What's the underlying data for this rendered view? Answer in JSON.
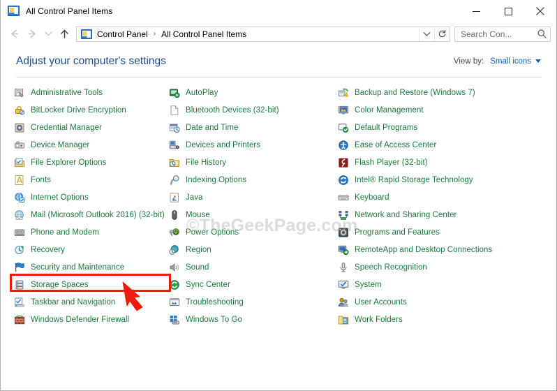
{
  "window": {
    "title": "All Control Panel Items",
    "title_icon": "control-panel-icon",
    "minimize_label": "Minimize",
    "maximize_label": "Maximize",
    "close_label": "Close"
  },
  "toolbar": {
    "back_label": "Back",
    "forward_label": "Forward",
    "recent_label": "Recent locations",
    "up_label": "Up",
    "breadcrumbs": [
      {
        "label": "Control Panel"
      },
      {
        "label": "All Control Panel Items"
      }
    ],
    "separator": "›",
    "address_dropdown_label": "Previous locations",
    "refresh_label": "Refresh",
    "search": {
      "placeholder": "Search Con...",
      "value": "",
      "icon": "search-icon"
    }
  },
  "header": {
    "title": "Adjust your computer's settings",
    "view_by_label": "View by:",
    "view_by_value": "Small icons"
  },
  "colors": {
    "link_green": "#1a7a3c",
    "title_blue": "#1f4e96",
    "accent_blue": "#0066cc",
    "annotation_red": "#f01b0c"
  },
  "annotations": {
    "highlight_target": "Mail (Microsoft Outlook 2016) (32-bit)",
    "arrow": "red-arrow-pointing-up-left",
    "watermark": "©TheGeekPage.com"
  },
  "columns": [
    {
      "items": [
        {
          "label": "Administrative Tools",
          "icon": "administrative-tools-icon"
        },
        {
          "label": "BitLocker Drive Encryption",
          "icon": "bitlocker-icon"
        },
        {
          "label": "Credential Manager",
          "icon": "credential-manager-icon"
        },
        {
          "label": "Device Manager",
          "icon": "device-manager-icon"
        },
        {
          "label": "File Explorer Options",
          "icon": "file-explorer-options-icon"
        },
        {
          "label": "Fonts",
          "icon": "fonts-icon"
        },
        {
          "label": "Internet Options",
          "icon": "internet-options-icon"
        },
        {
          "label": "Mail (Microsoft Outlook 2016) (32-bit)",
          "icon": "mail-icon"
        },
        {
          "label": "Phone and Modem",
          "icon": "phone-and-modem-icon"
        },
        {
          "label": "Recovery",
          "icon": "recovery-icon"
        },
        {
          "label": "Security and Maintenance",
          "icon": "security-and-maintenance-icon"
        },
        {
          "label": "Storage Spaces",
          "icon": "storage-spaces-icon"
        },
        {
          "label": "Taskbar and Navigation",
          "icon": "taskbar-and-navigation-icon"
        },
        {
          "label": "Windows Defender Firewall",
          "icon": "windows-defender-firewall-icon"
        }
      ]
    },
    {
      "items": [
        {
          "label": "AutoPlay",
          "icon": "autoplay-icon"
        },
        {
          "label": "Bluetooth Devices (32-bit)",
          "icon": "bluetooth-devices-icon"
        },
        {
          "label": "Date and Time",
          "icon": "date-and-time-icon"
        },
        {
          "label": "Devices and Printers",
          "icon": "devices-and-printers-icon"
        },
        {
          "label": "File History",
          "icon": "file-history-icon"
        },
        {
          "label": "Indexing Options",
          "icon": "indexing-options-icon"
        },
        {
          "label": "Java",
          "icon": "java-icon"
        },
        {
          "label": "Mouse",
          "icon": "mouse-icon"
        },
        {
          "label": "Power Options",
          "icon": "power-options-icon"
        },
        {
          "label": "Region",
          "icon": "region-icon"
        },
        {
          "label": "Sound",
          "icon": "sound-icon"
        },
        {
          "label": "Sync Center",
          "icon": "sync-center-icon"
        },
        {
          "label": "Troubleshooting",
          "icon": "troubleshooting-icon"
        },
        {
          "label": "Windows To Go",
          "icon": "windows-to-go-icon"
        }
      ]
    },
    {
      "items": [
        {
          "label": "Backup and Restore (Windows 7)",
          "icon": "backup-and-restore-icon"
        },
        {
          "label": "Color Management",
          "icon": "color-management-icon"
        },
        {
          "label": "Default Programs",
          "icon": "default-programs-icon"
        },
        {
          "label": "Ease of Access Center",
          "icon": "ease-of-access-icon"
        },
        {
          "label": "Flash Player (32-bit)",
          "icon": "flash-player-icon"
        },
        {
          "label": "Intel® Rapid Storage Technology",
          "icon": "intel-rst-icon"
        },
        {
          "label": "Keyboard",
          "icon": "keyboard-icon"
        },
        {
          "label": "Network and Sharing Center",
          "icon": "network-and-sharing-icon"
        },
        {
          "label": "Programs and Features",
          "icon": "programs-and-features-icon"
        },
        {
          "label": "RemoteApp and Desktop Connections",
          "icon": "remoteapp-icon"
        },
        {
          "label": "Speech Recognition",
          "icon": "speech-recognition-icon"
        },
        {
          "label": "System",
          "icon": "system-icon"
        },
        {
          "label": "User Accounts",
          "icon": "user-accounts-icon"
        },
        {
          "label": "Work Folders",
          "icon": "work-folders-icon"
        }
      ]
    }
  ]
}
